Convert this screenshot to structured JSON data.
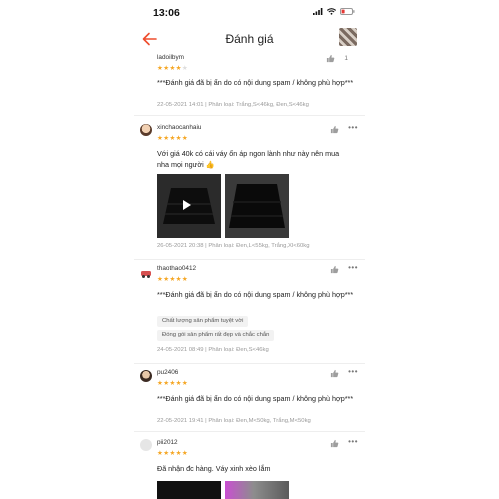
{
  "status": {
    "time": "13:06"
  },
  "header": {
    "title": "Đánh giá"
  },
  "reviews": [
    {
      "username": "ladoilbym",
      "stars": 4,
      "likes": "1",
      "text": "***Đánh giá đã bị ẩn do có nội dung spam / không phù hợp***",
      "meta": "22-05-2021 14:01 | Phân loại: Trắng,S<46kg, Đen,S<46kg"
    },
    {
      "username": "xinchaocanhaiu",
      "stars": 5,
      "text": "Với giá 40k có cái váy ổn áp ngon lành như này nên mua nha mọi người 👍",
      "meta": "26-05-2021 20:38 | Phân loại: Đen,L<55kg, Trắng,Xl<60kg"
    },
    {
      "username": "thaothao0412",
      "stars": 5,
      "text": "***Đánh giá đã bị ẩn do có nội dung spam / không phù hợp***",
      "tags": [
        "Chất lượng sản phẩm tuyệt vời",
        "Đóng gói sản phẩm rất đẹp và chắc chắn"
      ],
      "meta": "24-05-2021 08:49 | Phân loại: Đen,S<46kg"
    },
    {
      "username": "pu2406",
      "stars": 5,
      "text": "***Đánh giá đã bị ẩn do có nội dung spam / không phù hợp***",
      "meta": "22-05-2021 19:41 | Phân loại: Đen,M<50kg, Trắng,M<50kg"
    },
    {
      "username": "pii2012",
      "stars": 5,
      "text": "Đã nhận đc hàng. Váy xinh xèo lắm"
    }
  ],
  "colors": {
    "accent": "#ee4d2d",
    "star": "#f5a623"
  }
}
